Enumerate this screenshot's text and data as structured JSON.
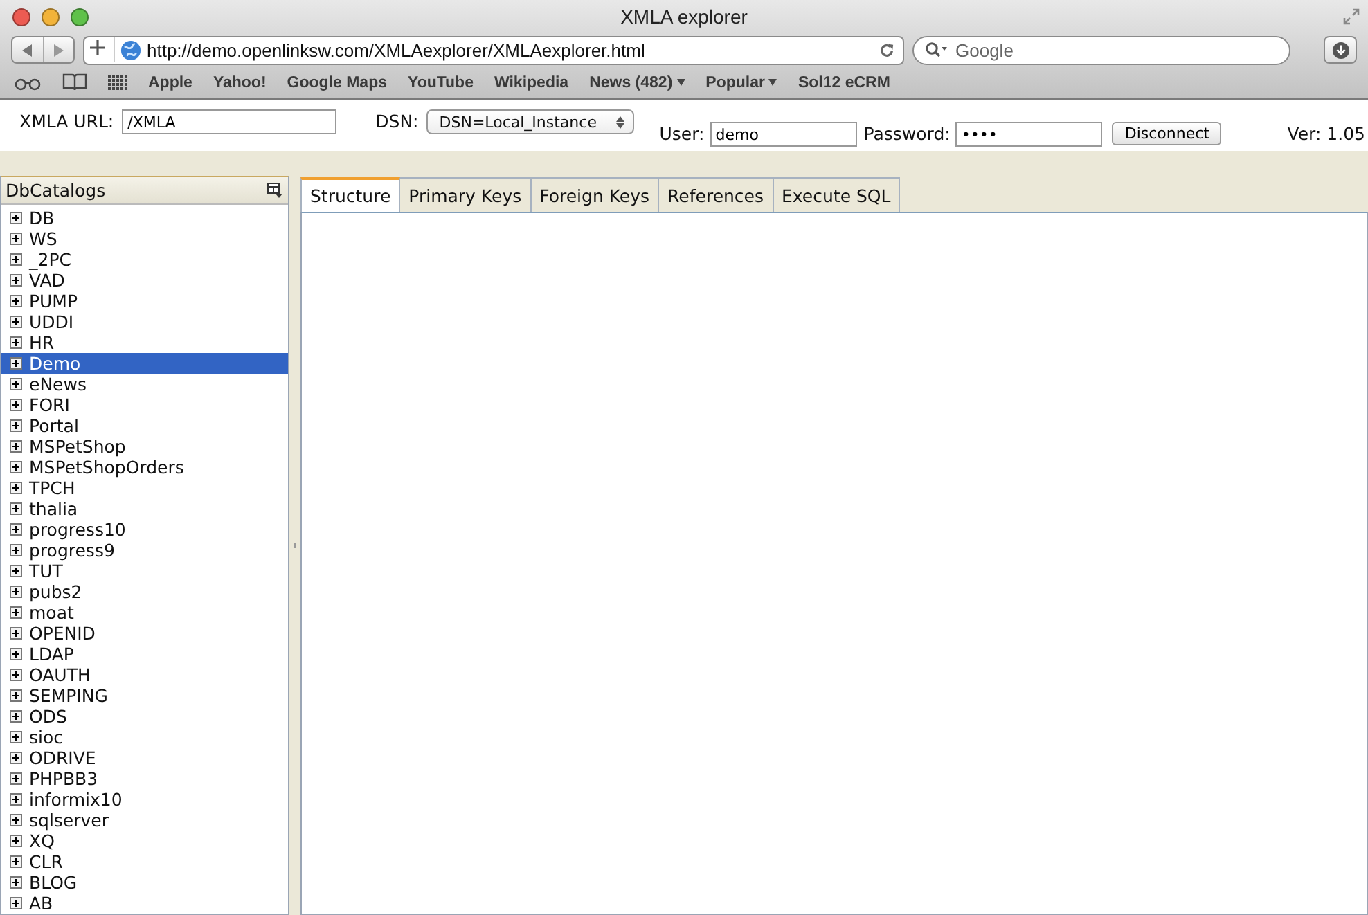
{
  "window": {
    "title": "XMLA explorer"
  },
  "browser": {
    "url": "http://demo.openlinksw.com/XMLAexplorer/XMLAexplorer.html",
    "search_placeholder": "Google",
    "bookmarks": [
      {
        "label": "Apple",
        "menu": false
      },
      {
        "label": "Yahoo!",
        "menu": false
      },
      {
        "label": "Google Maps",
        "menu": false
      },
      {
        "label": "YouTube",
        "menu": false
      },
      {
        "label": "Wikipedia",
        "menu": false
      },
      {
        "label": "News (482)",
        "menu": true
      },
      {
        "label": "Popular",
        "menu": true
      },
      {
        "label": "Sol12 eCRM",
        "menu": false
      }
    ]
  },
  "form": {
    "xmla_url_label": "XMLA URL:",
    "xmla_url": "/XMLA",
    "dsn_label": "DSN:",
    "dsn": "DSN=Local_Instance",
    "user_label": "User:",
    "user": "demo",
    "password_label": "Password:",
    "password": "••••",
    "disconnect": "Disconnect",
    "version": "Ver: 1.05"
  },
  "sidebar": {
    "title": "DbCatalogs",
    "items": [
      {
        "label": "DB",
        "selected": false
      },
      {
        "label": "WS",
        "selected": false
      },
      {
        "label": "_2PC",
        "selected": false
      },
      {
        "label": "VAD",
        "selected": false
      },
      {
        "label": "PUMP",
        "selected": false
      },
      {
        "label": "UDDI",
        "selected": false
      },
      {
        "label": "HR",
        "selected": false
      },
      {
        "label": "Demo",
        "selected": true
      },
      {
        "label": "eNews",
        "selected": false
      },
      {
        "label": "FORI",
        "selected": false
      },
      {
        "label": "Portal",
        "selected": false
      },
      {
        "label": "MSPetShop",
        "selected": false
      },
      {
        "label": "MSPetShopOrders",
        "selected": false
      },
      {
        "label": "TPCH",
        "selected": false
      },
      {
        "label": "thalia",
        "selected": false
      },
      {
        "label": "progress10",
        "selected": false
      },
      {
        "label": "progress9",
        "selected": false
      },
      {
        "label": "TUT",
        "selected": false
      },
      {
        "label": "pubs2",
        "selected": false
      },
      {
        "label": "moat",
        "selected": false
      },
      {
        "label": "OPENID",
        "selected": false
      },
      {
        "label": "LDAP",
        "selected": false
      },
      {
        "label": "OAUTH",
        "selected": false
      },
      {
        "label": "SEMPING",
        "selected": false
      },
      {
        "label": "ODS",
        "selected": false
      },
      {
        "label": "sioc",
        "selected": false
      },
      {
        "label": "ODRIVE",
        "selected": false
      },
      {
        "label": "PHPBB3",
        "selected": false
      },
      {
        "label": "informix10",
        "selected": false
      },
      {
        "label": "sqlserver",
        "selected": false
      },
      {
        "label": "XQ",
        "selected": false
      },
      {
        "label": "CLR",
        "selected": false
      },
      {
        "label": "BLOG",
        "selected": false
      },
      {
        "label": "AB",
        "selected": false
      }
    ]
  },
  "tabs": [
    {
      "label": "Structure",
      "selected": true
    },
    {
      "label": "Primary Keys",
      "selected": false
    },
    {
      "label": "Foreign Keys",
      "selected": false
    },
    {
      "label": "References",
      "selected": false
    },
    {
      "label": "Execute SQL",
      "selected": false
    }
  ]
}
